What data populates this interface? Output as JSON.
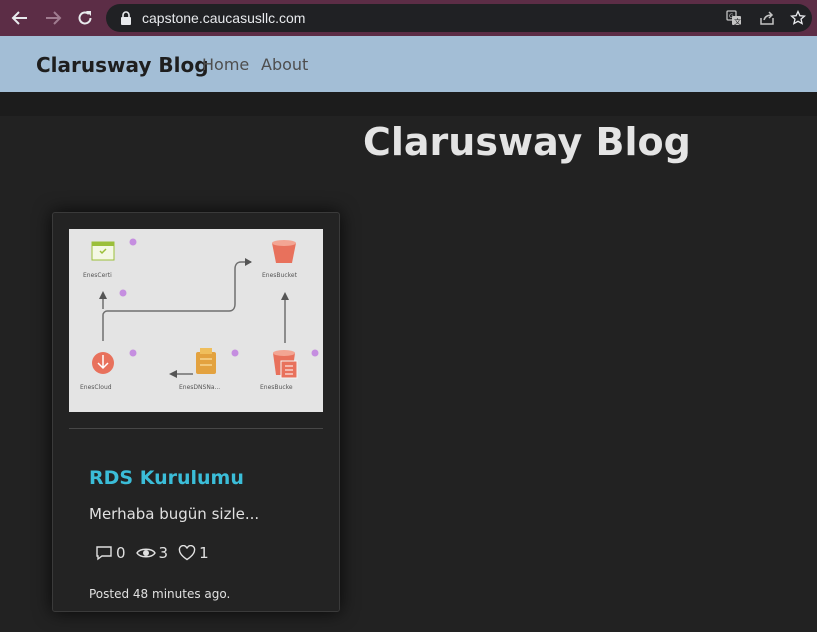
{
  "browser": {
    "url": "capstone.caucasusllc.com",
    "colors": {
      "frame": "#5c2d46",
      "address_bg": "#202124"
    }
  },
  "navbar": {
    "brand": "Clarusway Blog",
    "links": [
      {
        "label": "Home"
      },
      {
        "label": "About"
      }
    ],
    "colors": {
      "background": "#a3bed6"
    }
  },
  "main": {
    "heading": "Clarusway Blog"
  },
  "post": {
    "title": "RDS Kurulumu",
    "excerpt": "Merhaba bugün sizle...",
    "comments": "0",
    "views": "3",
    "likes": "1",
    "posted": "Posted 48 minutes ago.",
    "image_labels": [
      "EnesCerti",
      "EnesBucket",
      "EnesCloud",
      "EnesDNSNa...",
      "EnesBucke"
    ],
    "colors": {
      "title": "#3bbdd8"
    }
  }
}
